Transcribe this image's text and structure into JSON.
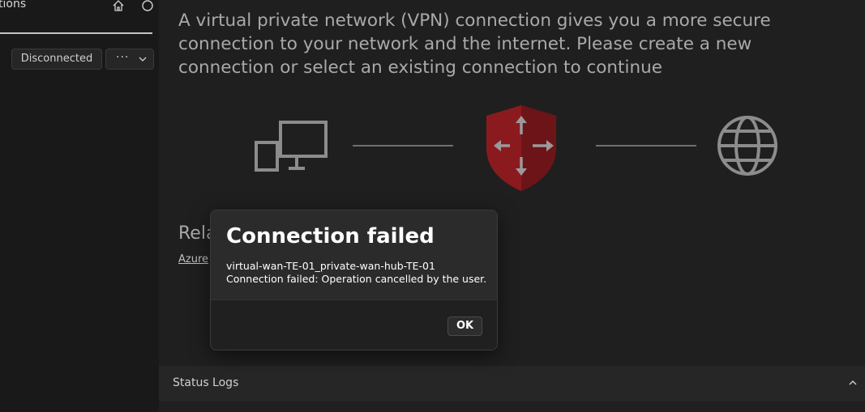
{
  "sidebar": {
    "title": "tions",
    "connection_status": "Disconnected",
    "more_label": "···"
  },
  "main": {
    "intro_text": "A virtual private network (VPN) connection gives you a more secure connection to your network and the internet. Please create a new connection or select an existing connection to continue",
    "related_title": "Rela",
    "related_link": "Azure"
  },
  "diagram": {
    "left_icon": "computer-icon",
    "center_icon": "vpn-shield-icon",
    "right_icon": "globe-icon",
    "shield_color": "#8b1a1f",
    "icon_color": "#8c8c8c"
  },
  "dialog": {
    "title": "Connection failed",
    "connection_name": "virtual-wan-TE-01_private-wan-hub-TE-01",
    "message": "Connection failed: Operation cancelled by the user.",
    "ok_label": "OK"
  },
  "status_logs": {
    "title": "Status Logs"
  }
}
